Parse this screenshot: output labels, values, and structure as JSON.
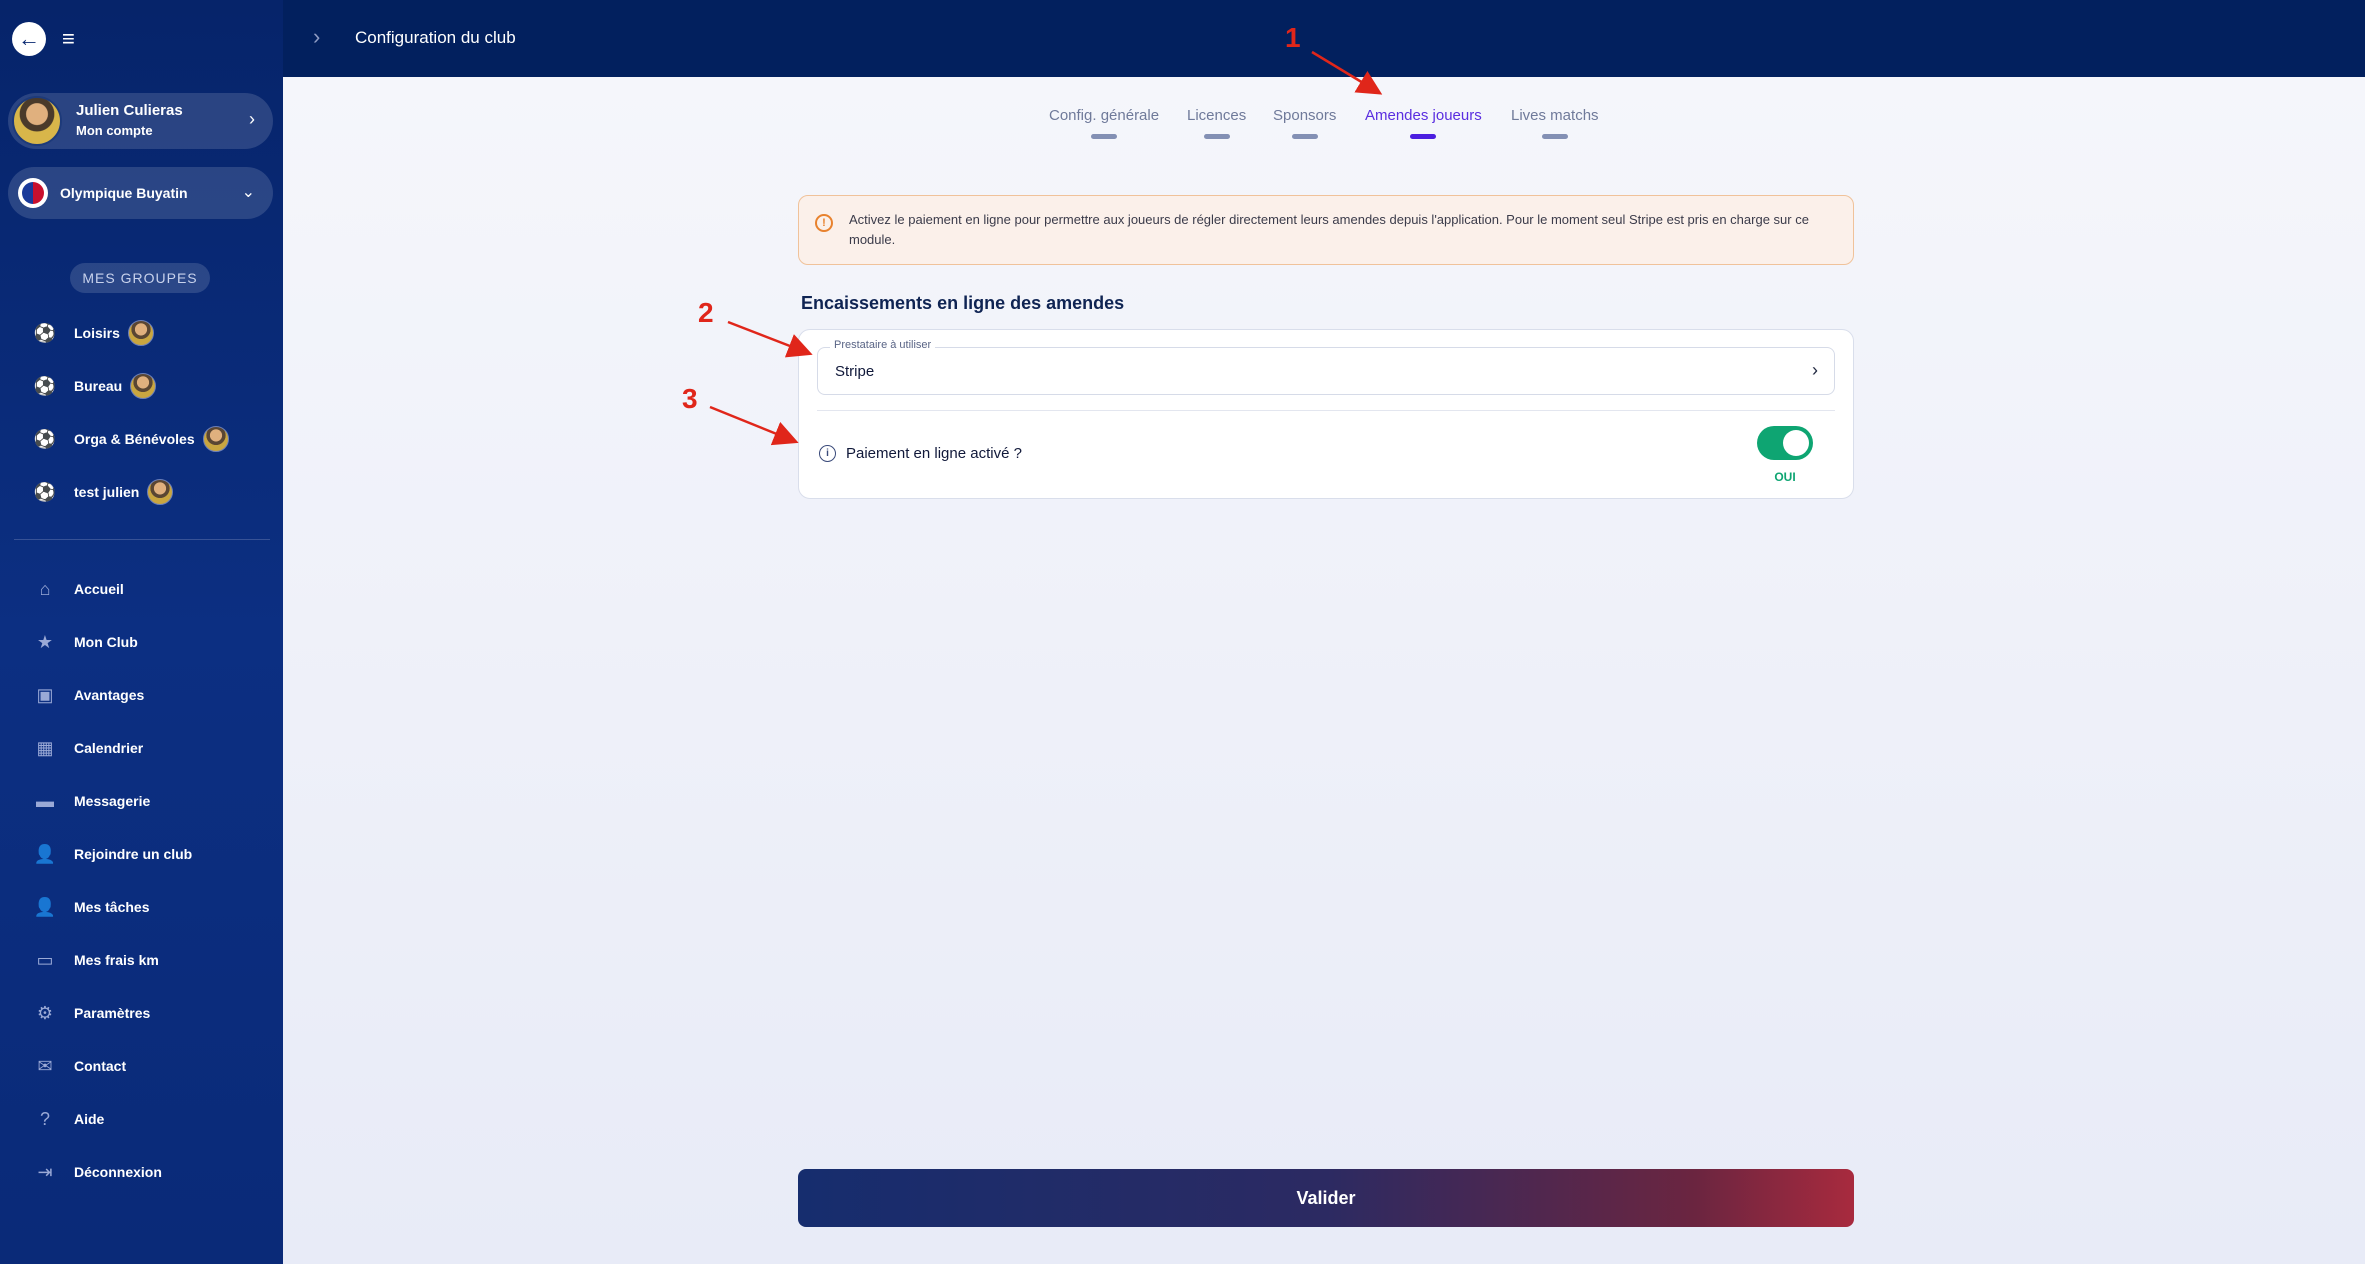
{
  "topbar": {
    "title": "Configuration du club"
  },
  "account": {
    "name": "Julien Culieras",
    "subtitle": "Mon compte"
  },
  "club": {
    "name": "Olympique Buyatin"
  },
  "groups": {
    "title": "MES GROUPES",
    "items": [
      {
        "label": "Loisirs",
        "icon": "soccer-ball-icon"
      },
      {
        "label": "Bureau",
        "icon": "soccer-ball-icon"
      },
      {
        "label": "Orga & Bénévoles",
        "icon": "soccer-ball-icon"
      },
      {
        "label": "test julien",
        "icon": "soccer-ball-icon"
      }
    ]
  },
  "nav": {
    "items": [
      {
        "label": "Accueil",
        "icon": "home-icon"
      },
      {
        "label": "Mon Club",
        "icon": "star-icon"
      },
      {
        "label": "Avantages",
        "icon": "gift-icon"
      },
      {
        "label": "Calendrier",
        "icon": "calendar-icon"
      },
      {
        "label": "Messagerie",
        "icon": "chat-icon"
      },
      {
        "label": "Rejoindre un club",
        "icon": "user-plus-icon"
      },
      {
        "label": "Mes tâches",
        "icon": "user-check-icon"
      },
      {
        "label": "Mes frais km",
        "icon": "car-icon"
      },
      {
        "label": "Paramètres",
        "icon": "gear-icon"
      },
      {
        "label": "Contact",
        "icon": "envelope-icon"
      },
      {
        "label": "Aide",
        "icon": "help-icon"
      },
      {
        "label": "Déconnexion",
        "icon": "logout-icon"
      }
    ]
  },
  "tabs": [
    {
      "label": "Config. générale",
      "active": false
    },
    {
      "label": "Licences",
      "active": false
    },
    {
      "label": "Sponsors",
      "active": false
    },
    {
      "label": "Amendes joueurs",
      "active": true
    },
    {
      "label": "Lives matchs",
      "active": false
    }
  ],
  "info": {
    "text": "Activez le paiement en ligne pour permettre aux joueurs de régler directement leurs amendes depuis l'application. Pour le moment seul Stripe est pris en charge sur ce module."
  },
  "section": {
    "title": "Encaissements en ligne des amendes"
  },
  "provider": {
    "label": "Prestataire à utiliser",
    "value": "Stripe"
  },
  "online_payment": {
    "label": "Paiement en ligne activé ?",
    "enabled": true,
    "state_label": "OUI"
  },
  "annotations": [
    "1",
    "2",
    "3"
  ],
  "submit": {
    "label": "Valider"
  },
  "colors": {
    "accent": "#4b1ee0",
    "toggle_on": "#0ea572",
    "annotation": "#e0261a",
    "topbar": "#02205e"
  }
}
